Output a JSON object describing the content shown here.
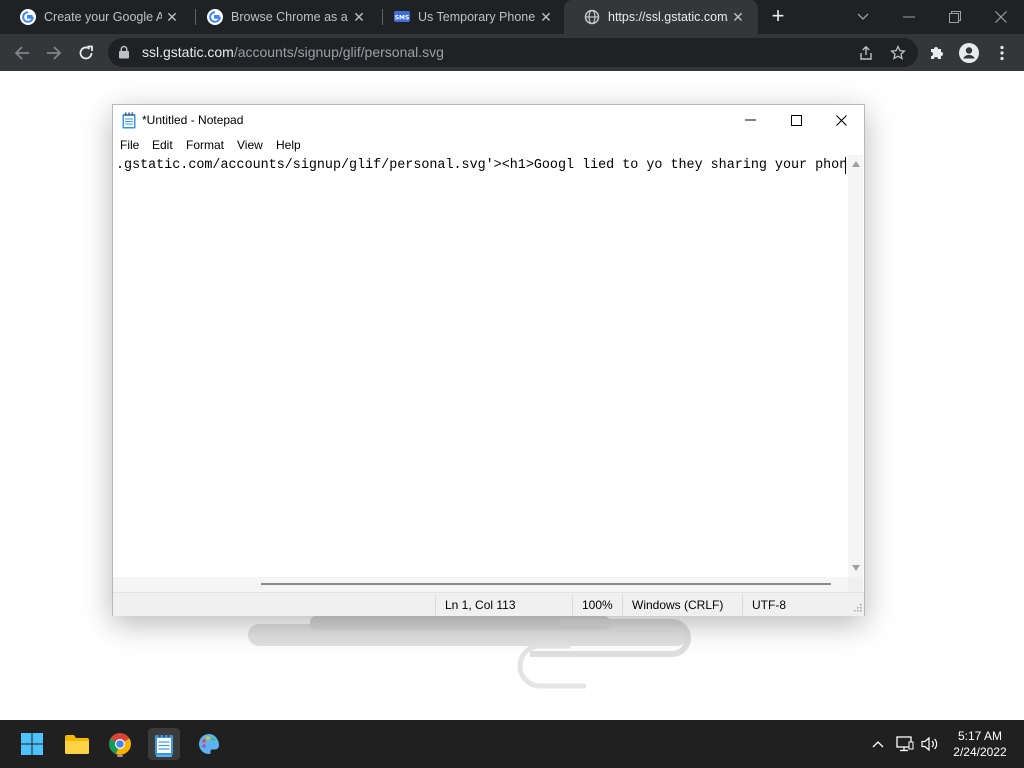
{
  "browser": {
    "tabs": [
      {
        "title": "Create your Google Ac",
        "active": false,
        "icon": "google-g-icon"
      },
      {
        "title": "Browse Chrome as a gu",
        "active": false,
        "icon": "google-g-icon"
      },
      {
        "title": "Us Temporary Phone N",
        "active": false,
        "icon": "sms-icon"
      },
      {
        "title": "https://ssl.gstatic.com/",
        "active": true,
        "icon": "globe-icon"
      }
    ],
    "url_host": "ssl.gstatic.com",
    "url_path": "/accounts/signup/glif/personal.svg"
  },
  "notepad": {
    "title": "*Untitled - Notepad",
    "menu": [
      "File",
      "Edit",
      "Format",
      "View",
      "Help"
    ],
    "text": ".gstatic.com/accounts/signup/glif/personal.svg'><h1>Googl lied to yo they sharing your phon",
    "status": {
      "position": "Ln 1, Col 113",
      "zoom": "100%",
      "line_ending": "Windows (CRLF)",
      "encoding": "UTF-8"
    }
  },
  "taskbar": {
    "time": "5:17 AM",
    "date": "2/24/2022"
  },
  "colors": {
    "chrome_tabstrip": "#202124",
    "chrome_toolbar": "#35363a",
    "taskbar": "#202020",
    "windows_accent": "#0078d4"
  }
}
